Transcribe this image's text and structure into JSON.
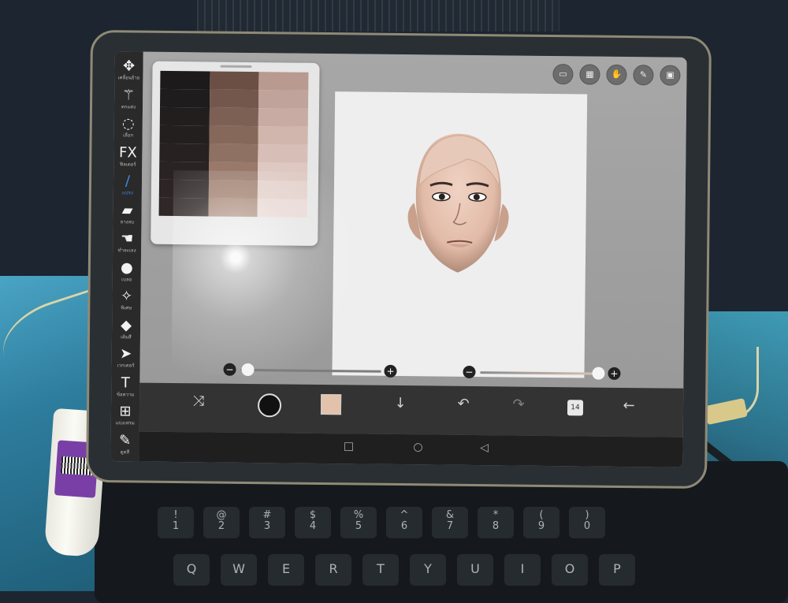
{
  "toolbar": {
    "items": [
      {
        "label": "เคลื่อนย้าย",
        "icon": "move-icon"
      },
      {
        "label": "ตกแต่ง",
        "icon": "magic-wand-icon"
      },
      {
        "label": "เลือก",
        "icon": "lasso-icon"
      },
      {
        "label": "ฟิลเตอร์",
        "icon": "fx-icon"
      },
      {
        "label": "แปรง",
        "icon": "brush-icon"
      },
      {
        "label": "ยางลบ",
        "icon": "eraser-icon"
      },
      {
        "label": "ทำละเลง",
        "icon": "smudge-icon"
      },
      {
        "label": "เบลอ",
        "icon": "blur-drop-icon"
      },
      {
        "label": "พิเศษ",
        "icon": "special-wand-icon"
      },
      {
        "label": "เติมสี",
        "icon": "fill-bucket-icon"
      },
      {
        "label": "เวกเตอร์",
        "icon": "arrow-cursor-icon"
      },
      {
        "label": "ข้อความ",
        "icon": "text-icon"
      },
      {
        "label": "แบ่งเฟรม",
        "icon": "frame-divider-icon"
      },
      {
        "label": "ดูดสี",
        "icon": "eyedropper-icon"
      }
    ],
    "active": "แปรง"
  },
  "top_icons": [
    "ruler-icon",
    "grid-icon",
    "material-icon",
    "pen-icon",
    "image-icon"
  ],
  "top_icon_glyphs": [
    "▭",
    "▦",
    "✋",
    "✎",
    "▣"
  ],
  "palette": {
    "colors": [
      "#1c1a1a",
      "#6b4f45",
      "#b89a90",
      "#1e1c1c",
      "#74574c",
      "#c0a39a",
      "#211e1e",
      "#7d6054",
      "#c8aca3",
      "#241f1f",
      "#86685b",
      "#d0b6ad",
      "#272121",
      "#8f7163",
      "#d7bfb7",
      "#2a2323",
      "#98796a",
      "#dec8c1",
      "#2d2525",
      "#a28373",
      "#e4d1cb",
      "#302727",
      "#ab8c7c",
      "#e9d9d4"
    ]
  },
  "sliders": {
    "size_label": "",
    "opacity_label": "",
    "size_value": 0.05,
    "opacity_value": 1.0
  },
  "bottom_bar": {
    "glyphs": {
      "transform": "⤨",
      "brush_preview": "●",
      "down": "↓",
      "undo": "↶",
      "redo": "↷",
      "layers": "14",
      "back": "←"
    },
    "current_color": "#e3c2ac",
    "layers_count": "14"
  },
  "nav": {
    "recent": "□",
    "home": "○",
    "back": "◁"
  },
  "keyboard": {
    "row1": [
      [
        "!",
        "1"
      ],
      [
        "@",
        "2"
      ],
      [
        "#",
        "3"
      ],
      [
        "$",
        "4"
      ],
      [
        "%",
        "5"
      ],
      [
        "^",
        "6"
      ],
      [
        "&",
        "7"
      ],
      [
        "*",
        "8"
      ],
      [
        "(",
        "9"
      ],
      [
        ")",
        "0"
      ]
    ],
    "row2": [
      "Q",
      "W",
      "E",
      "R",
      "T",
      "Y",
      "U",
      "I",
      "O",
      "P"
    ]
  }
}
